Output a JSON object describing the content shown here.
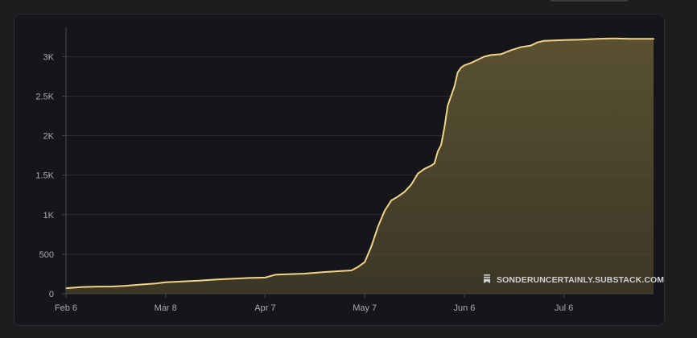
{
  "chart_data": {
    "type": "area",
    "title": "",
    "xlabel": "",
    "ylabel": "",
    "x_tick_labels": [
      "Feb 6",
      "Mar 8",
      "Apr 7",
      "May 7",
      "Jun 6",
      "Jul 6"
    ],
    "y_tick_labels": [
      "0",
      "500",
      "1K",
      "1.5K",
      "2K",
      "2.5K",
      "3K"
    ],
    "y_tick_values": [
      0,
      500,
      1000,
      1500,
      2000,
      2500,
      3000
    ],
    "ylim": [
      0,
      3370
    ],
    "x_range_days": [
      0,
      177
    ],
    "x_tick_days": [
      0,
      30,
      60,
      90,
      120,
      150
    ],
    "grid": "horizontal",
    "series": [
      {
        "values_by_day": [
          [
            0,
            70
          ],
          [
            5,
            85
          ],
          [
            10,
            90
          ],
          [
            14,
            92
          ],
          [
            18,
            100
          ],
          [
            22,
            115
          ],
          [
            27,
            130
          ],
          [
            30,
            145
          ],
          [
            35,
            155
          ],
          [
            40,
            165
          ],
          [
            45,
            180
          ],
          [
            50,
            190
          ],
          [
            55,
            200
          ],
          [
            60,
            205
          ],
          [
            63,
            240
          ],
          [
            66,
            245
          ],
          [
            72,
            255
          ],
          [
            75,
            265
          ],
          [
            78,
            275
          ],
          [
            84,
            290
          ],
          [
            86,
            295
          ],
          [
            88,
            340
          ],
          [
            90,
            400
          ],
          [
            92,
            600
          ],
          [
            94,
            850
          ],
          [
            96,
            1050
          ],
          [
            98,
            1180
          ],
          [
            100,
            1230
          ],
          [
            102,
            1290
          ],
          [
            104,
            1380
          ],
          [
            106,
            1520
          ],
          [
            108,
            1580
          ],
          [
            110,
            1620
          ],
          [
            111,
            1650
          ],
          [
            112,
            1800
          ],
          [
            113,
            1880
          ],
          [
            114,
            2100
          ],
          [
            115,
            2380
          ],
          [
            116,
            2500
          ],
          [
            117,
            2620
          ],
          [
            118,
            2800
          ],
          [
            119,
            2860
          ],
          [
            120,
            2890
          ],
          [
            122,
            2920
          ],
          [
            124,
            2960
          ],
          [
            126,
            3000
          ],
          [
            128,
            3020
          ],
          [
            131,
            3030
          ],
          [
            134,
            3080
          ],
          [
            137,
            3120
          ],
          [
            140,
            3140
          ],
          [
            142,
            3180
          ],
          [
            144,
            3200
          ],
          [
            150,
            3210
          ],
          [
            155,
            3215
          ],
          [
            160,
            3225
          ],
          [
            165,
            3230
          ],
          [
            170,
            3225
          ],
          [
            177,
            3225
          ]
        ]
      }
    ],
    "colors": {
      "line": "#f2d488",
      "area": "#5a5131",
      "grid": "#2a2b2f",
      "axis": "#44464b"
    },
    "watermark": "SONDERUNCERTAINLY.SUBSTACK.COM",
    "watermark_icon": "substack-icon"
  }
}
